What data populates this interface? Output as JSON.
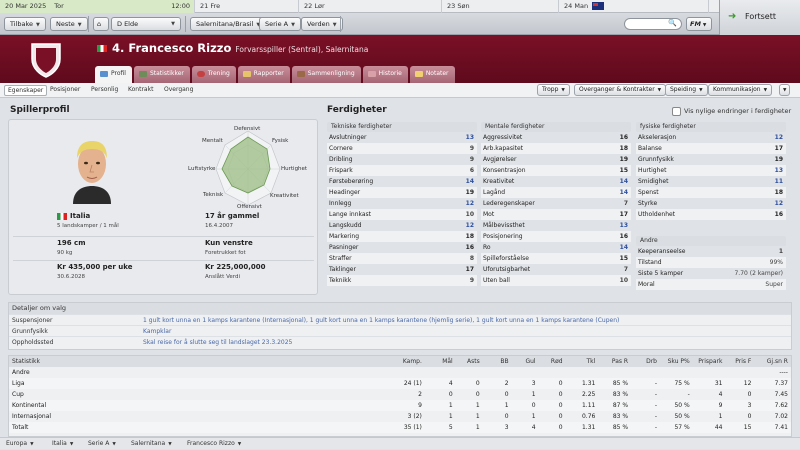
{
  "calendar": {
    "current_date": "20 Mar 2025",
    "current_day": "Tor",
    "time": "12:00",
    "days": [
      {
        "num": "21",
        "name": "Fre"
      },
      {
        "num": "22",
        "name": "Lør"
      },
      {
        "num": "23",
        "name": "Søn"
      },
      {
        "num": "24",
        "name": "Man"
      }
    ]
  },
  "nav": {
    "back": "Tilbake",
    "next": "Neste",
    "manager": "D Elde",
    "club_menu": "Salernitana/Brasil",
    "league_menu": "Serie A",
    "world_menu": "Verden",
    "fm": "FM",
    "continue": "Fortsett",
    "search_glyph": "🔍"
  },
  "player": {
    "name": "4. Francesco Rizzo",
    "role": "Forvarsspiller (Sentral), Salernitana"
  },
  "tabs": [
    "Profil",
    "Statistikker",
    "Trening",
    "Rapporter",
    "Sammenligning",
    "Historie",
    "Notater"
  ],
  "subtabs": [
    "Egenskaper",
    "Posisjoner",
    "Personlig",
    "Kontrakt",
    "Overgang"
  ],
  "actions": [
    "Tropp",
    "Overganger & Kontrakter",
    "Speiding",
    "Kommunikasjon"
  ],
  "profile": {
    "title": "Spillerprofil",
    "spider_labels": {
      "def": "Defensivt",
      "phys": "Fysisk",
      "speed": "Hurtighet",
      "creat": "Kreativitet",
      "off": "Offensivt",
      "tech": "Teknisk",
      "aerial": "Luftstyrke",
      "mental": "Mentalt"
    },
    "nation": "Italia",
    "caps": "5 landskamper / 1 mål",
    "age": "17 år gammel",
    "dob": "16.4.2007",
    "height": "196 cm",
    "weight": "90 kg",
    "foot": "Kun venstre",
    "foot_sub": "Foretrukket fot",
    "wage": "Kr 435,000 per uke",
    "contract_end": "30.6.2028",
    "value": "Kr 225,000,000",
    "value_sub": "Anslått Verdi"
  },
  "attributes": {
    "title": "Ferdigheter",
    "show_changes": "Vis nylige endringer i ferdigheter",
    "technical": {
      "title": "Tekniske ferdigheter",
      "rows": [
        [
          "Avslutninger",
          "13"
        ],
        [
          "Cornere",
          "9"
        ],
        [
          "Dribling",
          "9"
        ],
        [
          "Frispark",
          "6"
        ],
        [
          "Førsteberøring",
          "14"
        ],
        [
          "Headinger",
          "19"
        ],
        [
          "Innlegg",
          "12"
        ],
        [
          "Lange innkast",
          "10"
        ],
        [
          "Langskudd",
          "12"
        ],
        [
          "Markering",
          "18"
        ],
        [
          "Pasninger",
          "16"
        ],
        [
          "Straffer",
          "8"
        ],
        [
          "Taklinger",
          "17"
        ],
        [
          "Teknikk",
          "9"
        ]
      ]
    },
    "mental": {
      "title": "Mentale ferdigheter",
      "rows": [
        [
          "Aggressivitet",
          "16"
        ],
        [
          "Arb.kapasitet",
          "18"
        ],
        [
          "Avgjørelser",
          "19"
        ],
        [
          "Konsentrasjon",
          "15"
        ],
        [
          "Kreativitet",
          "14"
        ],
        [
          "Lagånd",
          "14"
        ],
        [
          "Lederegenskaper",
          "7"
        ],
        [
          "Mot",
          "17"
        ],
        [
          "Målbevissthet",
          "13"
        ],
        [
          "Posisjonering",
          "16"
        ],
        [
          "Ro",
          "14"
        ],
        [
          "Spilleforståelse",
          "15"
        ],
        [
          "Uforutsigbarhet",
          "7"
        ],
        [
          "Uten ball",
          "10"
        ]
      ]
    },
    "physical": {
      "title": "fysiske ferdigheter",
      "rows": [
        [
          "Akselerasjon",
          "12"
        ],
        [
          "Balanse",
          "17"
        ],
        [
          "Grunnfysikk",
          "19"
        ],
        [
          "Hurtighet",
          "13"
        ],
        [
          "Smidighet",
          "11"
        ],
        [
          "Spenst",
          "18"
        ],
        [
          "Styrke",
          "12"
        ],
        [
          "Utholdenhet",
          "16"
        ]
      ]
    },
    "other": {
      "title": "Andre",
      "rows": [
        [
          "Keeperanseelse",
          "1"
        ],
        [
          "Tilstand",
          "99%"
        ],
        [
          "Siste 5 kamper",
          "7.70 (2 kamper)"
        ],
        [
          "Moral",
          "Super"
        ]
      ]
    }
  },
  "details": {
    "title": "Detaljer om valg",
    "rows": [
      [
        "Suspensjoner",
        "1 gult kort unna en 1 kamps karantene (Internasjonal), 1 gult kort unna en 1 kamps karantene (hjemlig serie), 1 gult kort unna en 1 kamps karantene (Cupen)"
      ],
      [
        "Grunnfysikk",
        "Kampklar"
      ],
      [
        "Oppholdssted",
        "Skal reise for å slutte seg til landslaget 23.3.2025"
      ]
    ]
  },
  "stats": {
    "headers": [
      "Statistikk",
      "Kamp.",
      "Mål",
      "Asts",
      "BB",
      "Gul",
      "Rød",
      "Tkl",
      "Pas R",
      "Drb",
      "Sku P%",
      "Prispark",
      "Pris F",
      "Gj.sn R"
    ],
    "rows": [
      [
        "Andre",
        "",
        "",
        "",
        "",
        "",
        "",
        "",
        "",
        "",
        "",
        "",
        "",
        "----"
      ],
      [
        "Liga",
        "24 (1)",
        "4",
        "0",
        "2",
        "3",
        "0",
        "1.31",
        "85 %",
        "-",
        "75 %",
        "31",
        "12",
        "7.37"
      ],
      [
        "Cup",
        "2",
        "0",
        "0",
        "0",
        "1",
        "0",
        "2.25",
        "83 %",
        "-",
        "-",
        "4",
        "0",
        "7.45"
      ],
      [
        "Kontinental",
        "9",
        "1",
        "1",
        "1",
        "0",
        "0",
        "1.11",
        "87 %",
        "-",
        "50 %",
        "9",
        "3",
        "7.62"
      ],
      [
        "Internasjonal",
        "3 (2)",
        "1",
        "1",
        "0",
        "1",
        "0",
        "0.76",
        "83 %",
        "-",
        "50 %",
        "1",
        "0",
        "7.02"
      ],
      [
        "Totalt",
        "35 (1)",
        "5",
        "1",
        "3",
        "4",
        "0",
        "1.31",
        "85 %",
        "-",
        "57 %",
        "44",
        "15",
        "7.41"
      ]
    ]
  },
  "breadcrumb": [
    "Europa",
    "Italia",
    "Serie A",
    "Salernitana",
    "Francesco Rizzo"
  ],
  "colors": {
    "header": "#6e0d22",
    "accent_blue": "#2d4f9e",
    "continue_green": "#3d9a2e"
  }
}
